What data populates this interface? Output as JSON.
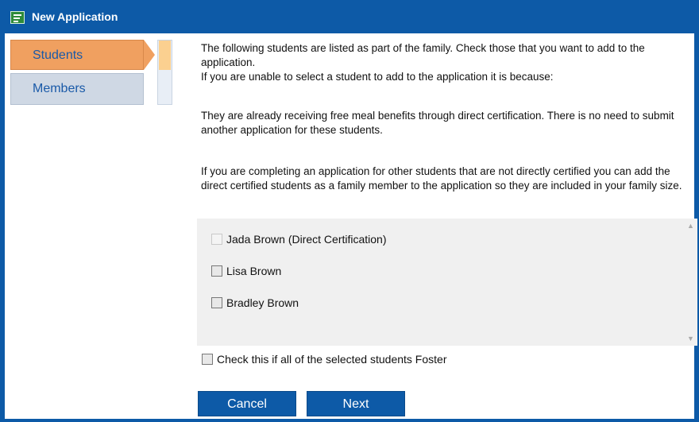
{
  "window": {
    "title": "New Application",
    "accent": "#0d5aa7"
  },
  "nav": {
    "items": [
      {
        "label": "Students",
        "active": true
      },
      {
        "label": "Members",
        "active": false
      }
    ]
  },
  "main": {
    "intro_line1": "The following students are listed as part of the family. Check those that you want to add to the application.",
    "intro_line2": "If you are unable to select a student to add to the application it is because:",
    "reason": "They are already receiving free meal benefits through direct certification. There is no need to submit another application for these students.",
    "note": "If you are completing an application for other students that are not directly certified you can add the direct certified students as a family member to the application so they are included in your family size."
  },
  "students": [
    {
      "name": "Jada Brown (Direct Certification)",
      "disabled": true,
      "checked": false
    },
    {
      "name": "Lisa Brown",
      "disabled": false,
      "checked": false
    },
    {
      "name": "Bradley Brown",
      "disabled": false,
      "checked": false
    }
  ],
  "foster_label": "Check this if all of the selected students Foster",
  "buttons": {
    "cancel": "Cancel",
    "next": "Next"
  },
  "icons": {
    "title": "application-form-icon",
    "scroll_up": "scroll-up-icon",
    "scroll_down": "scroll-down-icon"
  }
}
